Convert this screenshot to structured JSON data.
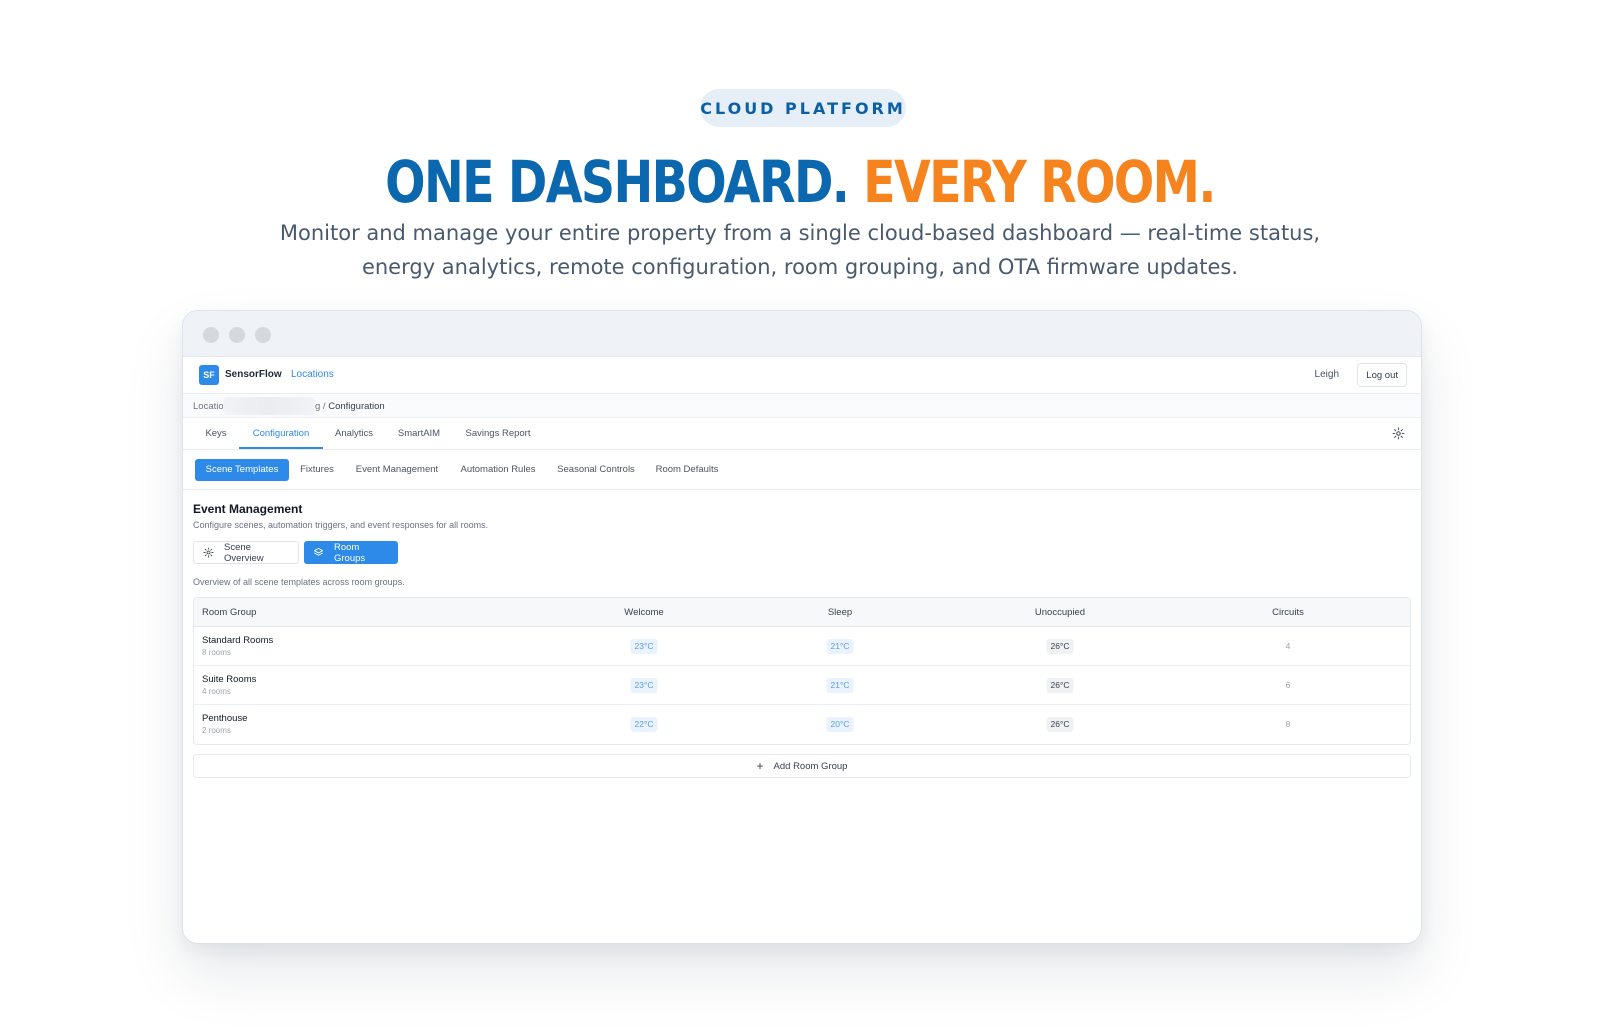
{
  "hero": {
    "eyebrow": "CLOUD PLATFORM",
    "headline_part1": "ONE DASHBOARD.",
    "headline_part2": "EVERY ROOM.",
    "subhead": "Monitor and manage your entire property from a single cloud-based dashboard — real-time status, energy analytics, remote configuration, room grouping, and OTA firmware updates.",
    "colors": {
      "blue": "#0b67ae",
      "orange": "#f5841f"
    }
  },
  "app": {
    "logo": "SF",
    "brand": "SensorFlow",
    "nav_locations": "Locations",
    "user": "Leigh",
    "logout": "Log out",
    "accent": "#2d8ae8"
  },
  "breadcrumb": {
    "first": "Locatio",
    "last_prefix": "g /",
    "current": "Configuration"
  },
  "tabs": [
    "Keys",
    "Configuration",
    "Analytics",
    "SmartAIM",
    "Savings Report"
  ],
  "active_tab": "Configuration",
  "subtabs": [
    "Scene Templates",
    "Fixtures",
    "Event Management",
    "Automation Rules",
    "Seasonal Controls",
    "Room Defaults"
  ],
  "active_subtab": "Scene Templates",
  "section": {
    "title": "Event Management",
    "description": "Configure scenes, automation triggers, and event responses for all rooms.",
    "toggle_overview": "Scene Overview",
    "toggle_groups": "Room Groups",
    "active_toggle": "Room Groups",
    "table_description": "Overview of all scene templates across room groups."
  },
  "table": {
    "headers": [
      "Room Group",
      "Welcome",
      "Sleep",
      "Unoccupied",
      "Circuits"
    ],
    "rows": [
      {
        "name": "Standard Rooms",
        "count": "8 rooms",
        "welcome": "23°C",
        "sleep": "21°C",
        "unoccupied": "26°C",
        "circuits": "4"
      },
      {
        "name": "Suite Rooms",
        "count": "4 rooms",
        "welcome": "23°C",
        "sleep": "21°C",
        "unoccupied": "26°C",
        "circuits": "6"
      },
      {
        "name": "Penthouse",
        "count": "2 rooms",
        "welcome": "22°C",
        "sleep": "20°C",
        "unoccupied": "26°C",
        "circuits": "8"
      }
    ],
    "add_label": "Add Room Group"
  }
}
